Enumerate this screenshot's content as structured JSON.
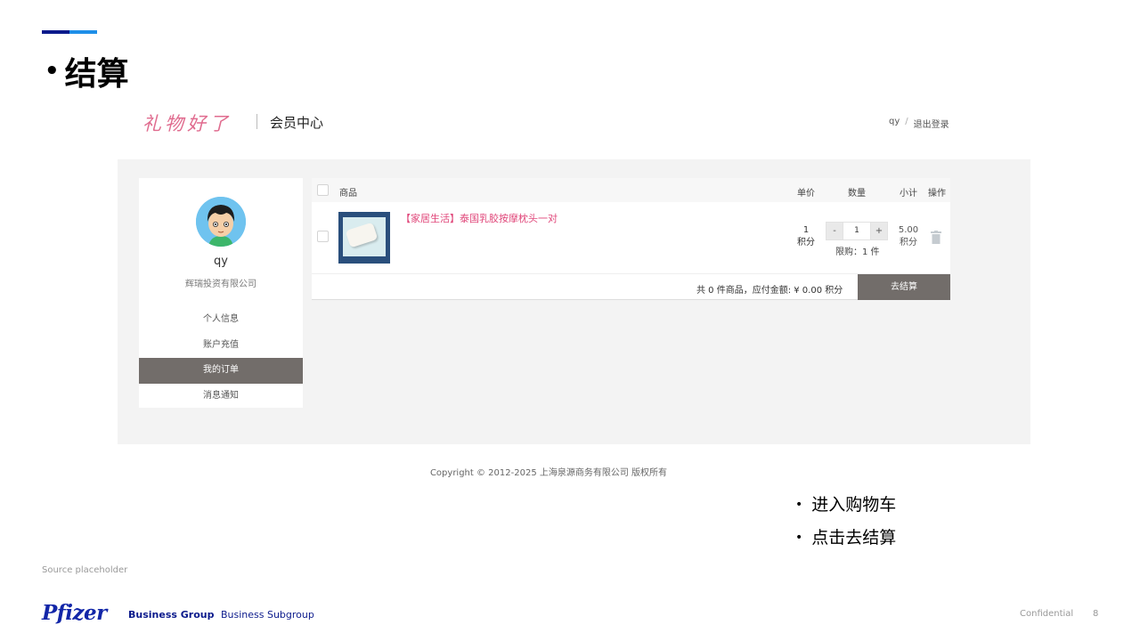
{
  "slide": {
    "title_bullet": "•",
    "title": "结算",
    "source": "Source placeholder",
    "page_number": "8",
    "confidential": "Confidential",
    "bullets": [
      "进入购物车",
      "点击去结算"
    ]
  },
  "footer": {
    "brand": "Pfizer",
    "business_group": "Business Group",
    "business_subgroup": "Business Subgroup"
  },
  "site": {
    "logo_text": "礼物好了",
    "section_title": "会员中心",
    "username_link": "qy",
    "separator": "/",
    "logout_link": "退出登录",
    "copyright": "Copyright © 2012-2025 上海泉源商务有限公司 版权所有"
  },
  "sidebar": {
    "username": "qy",
    "company": "辉瑞投资有限公司",
    "menu": [
      {
        "label": "个人信息",
        "active": false
      },
      {
        "label": "账户充值",
        "active": false
      },
      {
        "label": "我的订单",
        "active": true
      },
      {
        "label": "消息通知",
        "active": false
      }
    ]
  },
  "cart": {
    "columns": {
      "product": "商品",
      "unit_price": "单价",
      "quantity": "数量",
      "subtotal": "小计",
      "action": "操作"
    },
    "items": [
      {
        "name": "【家居生活】泰国乳胶按摩枕头一对",
        "price": "1",
        "price_unit": "积分",
        "qty_minus": "-",
        "qty_value": "1",
        "qty_plus": "+",
        "limit": "限购：1 件",
        "subtotal": "5.00",
        "subtotal_unit": "积分",
        "delete_icon": "trash-icon"
      }
    ],
    "summary": "共 0 件商品，应付金额: ¥  0.00 积分",
    "checkout_label": "去结算"
  },
  "colors": {
    "accent_dark": "#0b1a8c",
    "accent_light": "#1e8fe8",
    "product_link": "#e0477a",
    "active_menu": "#726d6a",
    "logo": "#e06c8f"
  }
}
